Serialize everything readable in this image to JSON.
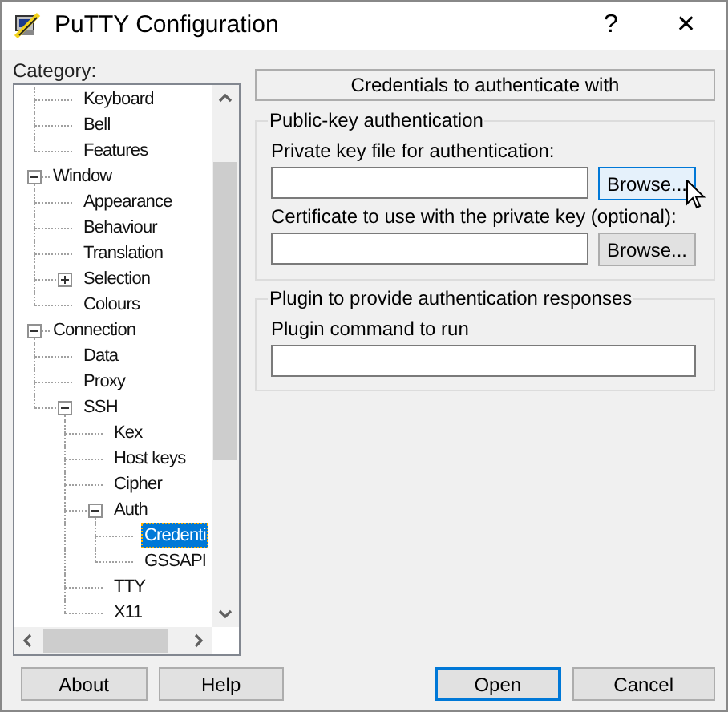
{
  "window": {
    "title": "PuTTY Configuration",
    "help_glyph": "?",
    "close_glyph": "✕"
  },
  "category_label": "Category:",
  "tree": {
    "items": [
      {
        "kind": "continuation",
        "children": [
          {
            "label": "Keyboard",
            "selected": false
          },
          {
            "label": "Bell",
            "selected": false
          },
          {
            "label": "Features",
            "selected": false
          }
        ]
      },
      {
        "label": "Window",
        "selected": false,
        "expanded": true,
        "children": [
          {
            "label": "Appearance",
            "selected": false
          },
          {
            "label": "Behaviour",
            "selected": false
          },
          {
            "label": "Translation",
            "selected": false
          },
          {
            "label": "Selection",
            "selected": false,
            "expanded": false
          },
          {
            "label": "Colours",
            "selected": false
          }
        ]
      },
      {
        "label": "Connection",
        "selected": false,
        "expanded": true,
        "children": [
          {
            "label": "Data",
            "selected": false
          },
          {
            "label": "Proxy",
            "selected": false
          },
          {
            "label": "SSH",
            "selected": false,
            "expanded": true,
            "children": [
              {
                "label": "Kex",
                "selected": false
              },
              {
                "label": "Host keys",
                "selected": false
              },
              {
                "label": "Cipher",
                "selected": false
              },
              {
                "label": "Auth",
                "selected": false,
                "expanded": true,
                "children": [
                  {
                    "label": "Credenti",
                    "selected": true
                  },
                  {
                    "label": "GSSAPI",
                    "selected": false
                  }
                ]
              },
              {
                "label": "TTY",
                "selected": false
              },
              {
                "label": "X11",
                "selected": false
              }
            ]
          }
        ]
      }
    ]
  },
  "panel": {
    "heading": "Credentials to authenticate with",
    "groups": [
      {
        "title": "Public-key authentication",
        "fields": [
          {
            "label": "Private key file for authentication:",
            "button": {
              "label": "Browse...",
              "hovered": true
            }
          },
          {
            "label": "Certificate to use with the private key (optional):",
            "button": {
              "label": "Browse...",
              "hovered": false
            }
          }
        ]
      },
      {
        "title": "Plugin to provide authentication responses",
        "fields": [
          {
            "label": "Plugin command to run"
          }
        ]
      }
    ]
  },
  "buttons": [
    {
      "label": "About",
      "default": false
    },
    {
      "label": "Help",
      "default": false
    },
    {
      "label": "Open",
      "default": true
    },
    {
      "label": "Cancel",
      "default": false
    }
  ]
}
